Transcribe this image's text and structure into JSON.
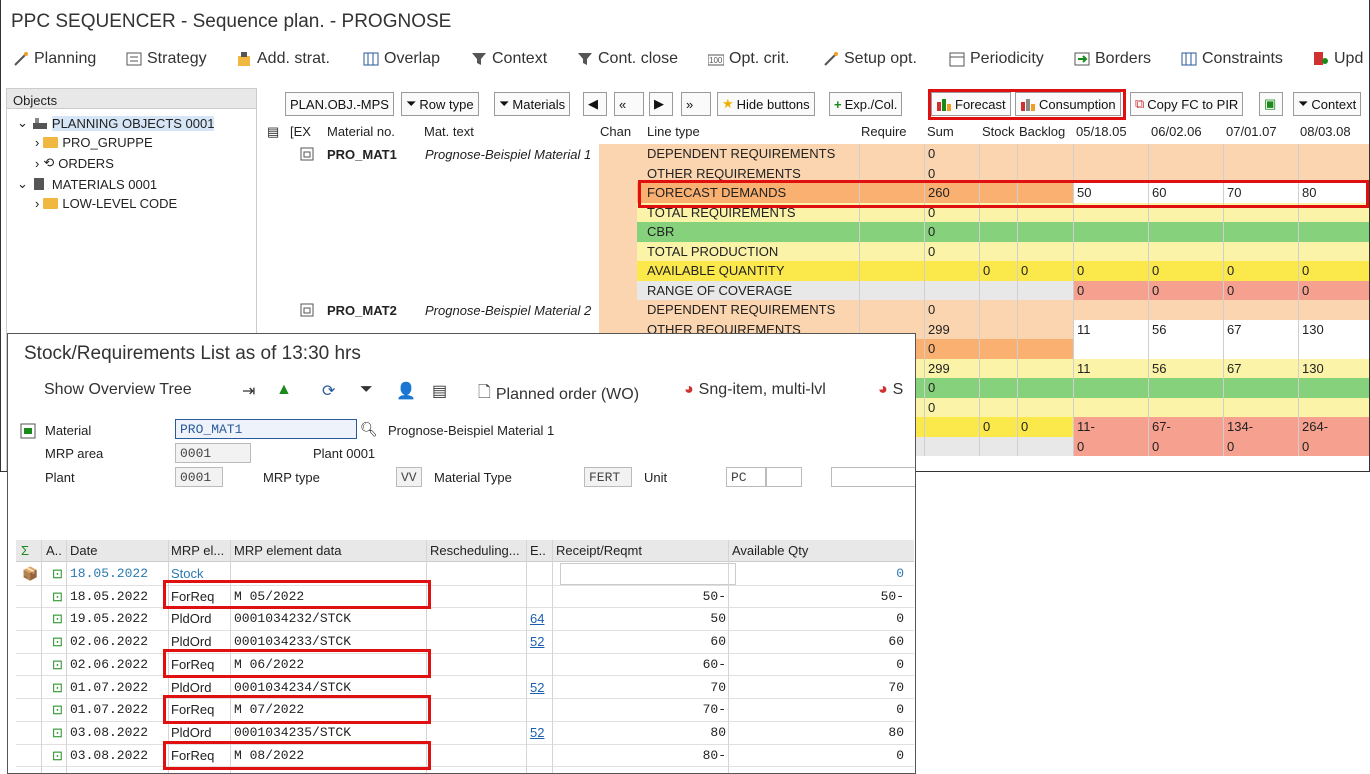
{
  "bg_window": {
    "title": "PPC SEQUENCER - Sequence plan. - PROGNOSE",
    "menu": [
      "Planning",
      "Strategy",
      "Add. strat.",
      "Overlap",
      "Context",
      "Cont. close",
      "Opt. crit.",
      "Setup opt.",
      "Periodicity",
      "Borders",
      "Constraints",
      "Upd"
    ],
    "objects_header": "Objects",
    "tree": [
      "PLANNING OBJECTS 0001",
      "PRO_GRUPPE",
      "ORDERS",
      "MATERIALS 0001",
      "LOW-LEVEL CODE"
    ],
    "toolbar": {
      "plan_obj": "PLAN.OBJ.-MPS",
      "row_type": "Row type",
      "materials": "Materials",
      "hide_buttons": "Hide buttons",
      "exp_col": "Exp./Col.",
      "forecast": "Forecast",
      "consumption": "Consumption",
      "copy_fc": "Copy FC to PIR",
      "context": "Context"
    },
    "columns": {
      "ex": "[EX",
      "material": "Material no.",
      "mat_text": "Mat. text",
      "chan": "Chan",
      "line_type": "Line type",
      "require": "Require",
      "sum": "Sum",
      "stock": "Stock",
      "backlog": "Backlog",
      "p1": "05/18.05",
      "p2": "06/02.06",
      "p3": "07/01.07",
      "p4": "08/03.08"
    },
    "materials": [
      {
        "no": "PRO_MAT1",
        "text": "Prognose-Beispiel Material 1"
      },
      {
        "no": "PRO_MAT2",
        "text": "Prognose-Beispiel Material 2"
      }
    ],
    "rows": [
      {
        "lt": "DEPENDENT REQUIREMENTS",
        "sum": "0",
        "stk": "",
        "bkl": "",
        "p": [
          "",
          "",
          "",
          ""
        ],
        "bg": "#fbd5b0"
      },
      {
        "lt": "OTHER REQUIREMENTS",
        "sum": "0",
        "stk": "",
        "bkl": "",
        "p": [
          "",
          "",
          "",
          ""
        ],
        "bg": "#fbd5b0"
      },
      {
        "lt": "FORECAST DEMANDS",
        "sum": "260",
        "stk": "",
        "bkl": "",
        "p": [
          "50",
          "60",
          "70",
          "80"
        ],
        "bg": "#f9b070"
      },
      {
        "lt": "TOTAL REQUIREMENTS",
        "sum": "0",
        "stk": "",
        "bkl": "",
        "p": [
          "",
          "",
          "",
          ""
        ],
        "bg": "#fbf3a8"
      },
      {
        "lt": "CBR",
        "sum": "0",
        "stk": "",
        "bkl": "",
        "p": [
          "",
          "",
          "",
          ""
        ],
        "bg": "#86d27c"
      },
      {
        "lt": "TOTAL PRODUCTION",
        "sum": "0",
        "stk": "",
        "bkl": "",
        "p": [
          "",
          "",
          "",
          ""
        ],
        "bg": "#fbf3a8"
      },
      {
        "lt": "AVAILABLE QUANTITY",
        "sum": "",
        "stk": "0",
        "bkl": "0",
        "p": [
          "0",
          "0",
          "0",
          "0"
        ],
        "bg": "#fbe84a"
      },
      {
        "lt": "RANGE OF COVERAGE",
        "sum": "",
        "stk": "",
        "bkl": "",
        "p": [
          "0",
          "0",
          "0",
          "0"
        ],
        "bg": "#e8e8e8"
      },
      {
        "lt": "DEPENDENT REQUIREMENTS",
        "sum": "0",
        "stk": "",
        "bkl": "",
        "p": [
          "",
          "",
          "",
          ""
        ],
        "bg": "#fbd5b0"
      },
      {
        "lt": "OTHER REQUIREMENTS",
        "sum": "299",
        "stk": "",
        "bkl": "",
        "p": [
          "11",
          "56",
          "67",
          "130"
        ],
        "bg": "#fbd5b0"
      },
      {
        "lt": "",
        "sum": "0",
        "stk": "",
        "bkl": "",
        "p": [
          "",
          "",
          "",
          ""
        ],
        "bg": "#f9b070"
      },
      {
        "lt": "",
        "sum": "299",
        "stk": "",
        "bkl": "",
        "p": [
          "11",
          "56",
          "67",
          "130"
        ],
        "bg": "#fbf3a8"
      },
      {
        "lt": "",
        "sum": "0",
        "stk": "",
        "bkl": "",
        "p": [
          "",
          "",
          "",
          ""
        ],
        "bg": "#86d27c"
      },
      {
        "lt": "",
        "sum": "0",
        "stk": "",
        "bkl": "",
        "p": [
          "",
          "",
          "",
          ""
        ],
        "bg": "#fbf3a8"
      },
      {
        "lt": "",
        "sum": "",
        "stk": "0",
        "bkl": "0",
        "p": [
          "11-",
          "67-",
          "134-",
          "264-"
        ],
        "bg": "#fbe84a"
      },
      {
        "lt": "",
        "sum": "",
        "stk": "",
        "bkl": "",
        "p": [
          "0",
          "0",
          "0",
          "0"
        ],
        "bg": "#e8e8e8"
      }
    ]
  },
  "fg_window": {
    "title": "Stock/Requirements List as of 13:30 hrs",
    "toolbar": {
      "overview": "Show Overview Tree",
      "planned_order": "Planned order (WO)",
      "sng_item": "Sng-item, multi-lvl",
      "s": "S"
    },
    "material_label": "Material",
    "material_value": "PRO_MAT1",
    "material_desc": "Prognose-Beispiel Material 1",
    "mrp_area_label": "MRP area",
    "mrp_area_value": "0001",
    "mrp_area_desc": "Plant 0001",
    "plant_label": "Plant",
    "plant_value": "0001",
    "mrp_type_label": "MRP type",
    "mrp_type_value": "VV",
    "mat_type_label": "Material Type",
    "mat_type_value": "FERT",
    "unit_label": "Unit",
    "unit_value": "PC",
    "columns": {
      "sigma": "Σ",
      "a": "A..",
      "date": "Date",
      "mrp_el": "MRP el...",
      "mrp_data": "MRP element data",
      "resched": "Rescheduling...",
      "e": "E..",
      "receipt": "Receipt/Reqmt",
      "avail": "Available Qty"
    },
    "rows": [
      {
        "date": "18.05.2022",
        "el": "Stock",
        "data": "",
        "resched": "",
        "receipt": "",
        "avail": "0",
        "stock": true
      },
      {
        "date": "18.05.2022",
        "el": "ForReq",
        "data": "M 05/2022",
        "resched": "",
        "receipt": "50-",
        "avail": "50-"
      },
      {
        "date": "19.05.2022",
        "el": "PldOrd",
        "data": "0001034232/STCK",
        "resched": "64",
        "receipt": "50",
        "avail": "0"
      },
      {
        "date": "02.06.2022",
        "el": "PldOrd",
        "data": "0001034233/STCK",
        "resched": "52",
        "receipt": "60",
        "avail": "60"
      },
      {
        "date": "02.06.2022",
        "el": "ForReq",
        "data": "M 06/2022",
        "resched": "",
        "receipt": "60-",
        "avail": "0"
      },
      {
        "date": "01.07.2022",
        "el": "PldOrd",
        "data": "0001034234/STCK",
        "resched": "52",
        "receipt": "70",
        "avail": "70"
      },
      {
        "date": "01.07.2022",
        "el": "ForReq",
        "data": "M 07/2022",
        "resched": "",
        "receipt": "70-",
        "avail": "0"
      },
      {
        "date": "03.08.2022",
        "el": "PldOrd",
        "data": "0001034235/STCK",
        "resched": "52",
        "receipt": "80",
        "avail": "80"
      },
      {
        "date": "03.08.2022",
        "el": "ForReq",
        "data": "M 08/2022",
        "resched": "",
        "receipt": "80-",
        "avail": "0"
      }
    ]
  }
}
